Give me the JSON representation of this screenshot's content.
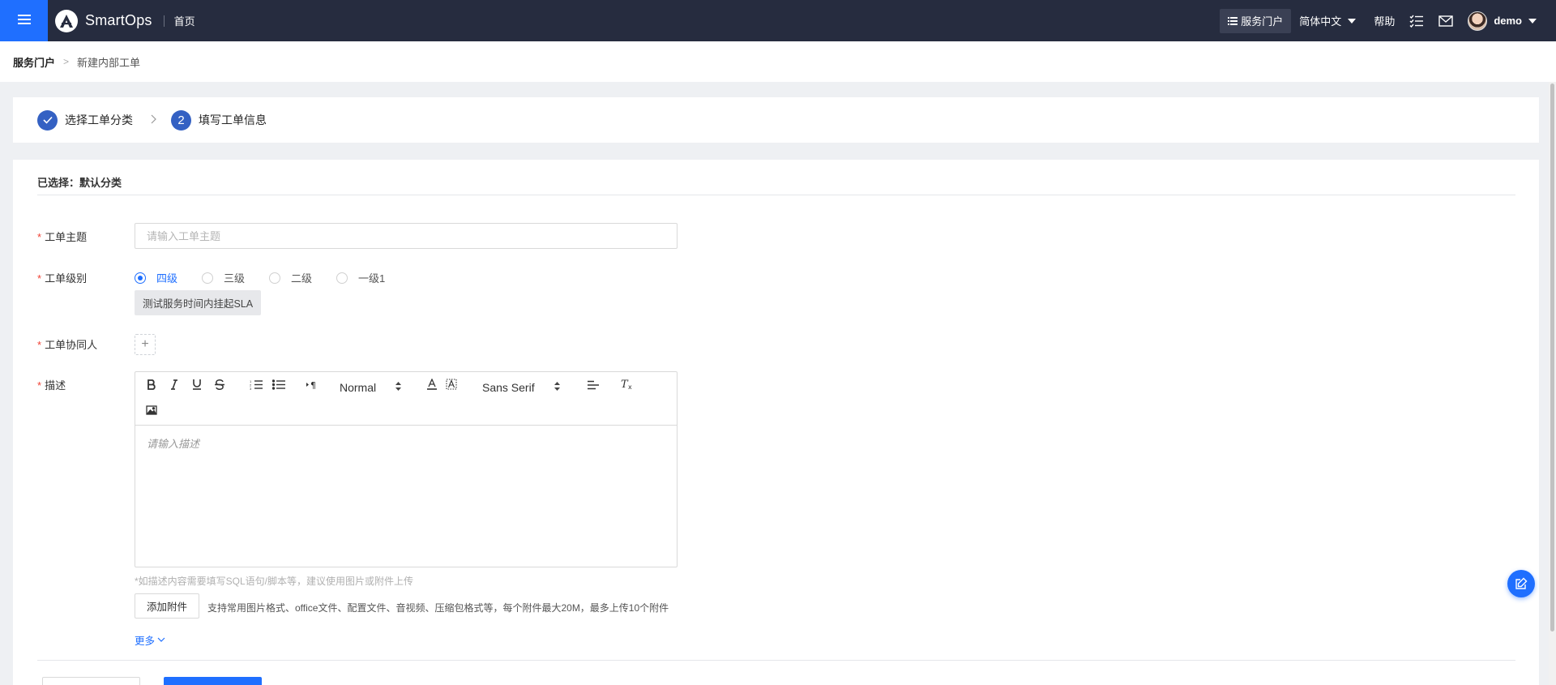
{
  "topbar": {
    "app_name": "SmartOps",
    "home": "首页",
    "portal": "服务门户",
    "language": "简体中文",
    "help": "帮助",
    "user": "demo",
    "accent": "#1f6fff",
    "bg": "#262c3f"
  },
  "breadcrumb": {
    "root": "服务门户",
    "current": "新建内部工单"
  },
  "steps": [
    {
      "index": "✓",
      "label": "选择工单分类",
      "state": "done"
    },
    {
      "index": "2",
      "label": "填写工单信息",
      "state": "active"
    }
  ],
  "form": {
    "selected_category": "已选择：默认分类",
    "subject": {
      "label": "工单主题",
      "placeholder": "请输入工单主题"
    },
    "level": {
      "label": "工单级别",
      "options": [
        "四级",
        "三级",
        "二级",
        "一级1"
      ],
      "selected": "四级",
      "sla_tag": "测试服务时间内挂起SLA"
    },
    "collaborator": {
      "label": "工单协同人",
      "add": "+"
    },
    "description": {
      "label": "描述",
      "placeholder": "请输入描述",
      "toolbar": {
        "header_select": "Normal",
        "font_select": "Sans Serif",
        "icons": [
          "bold-icon",
          "italic-icon",
          "underline-icon",
          "strike-icon",
          "ordered-list-icon",
          "bullet-list-icon",
          "text-direction-icon",
          "text-color-icon",
          "background-color-icon",
          "align-icon",
          "clear-format-icon",
          "image-icon"
        ]
      },
      "hint": "*如描述内容需要填写SQL语句/脚本等，建议使用图片或附件上传"
    },
    "attachment": {
      "button": "添加附件",
      "description": "支持常用图片格式、office文件、配置文件、音视频、压缩包格式等，每个附件最大20M，最多上传10个附件"
    },
    "more": "更多"
  }
}
